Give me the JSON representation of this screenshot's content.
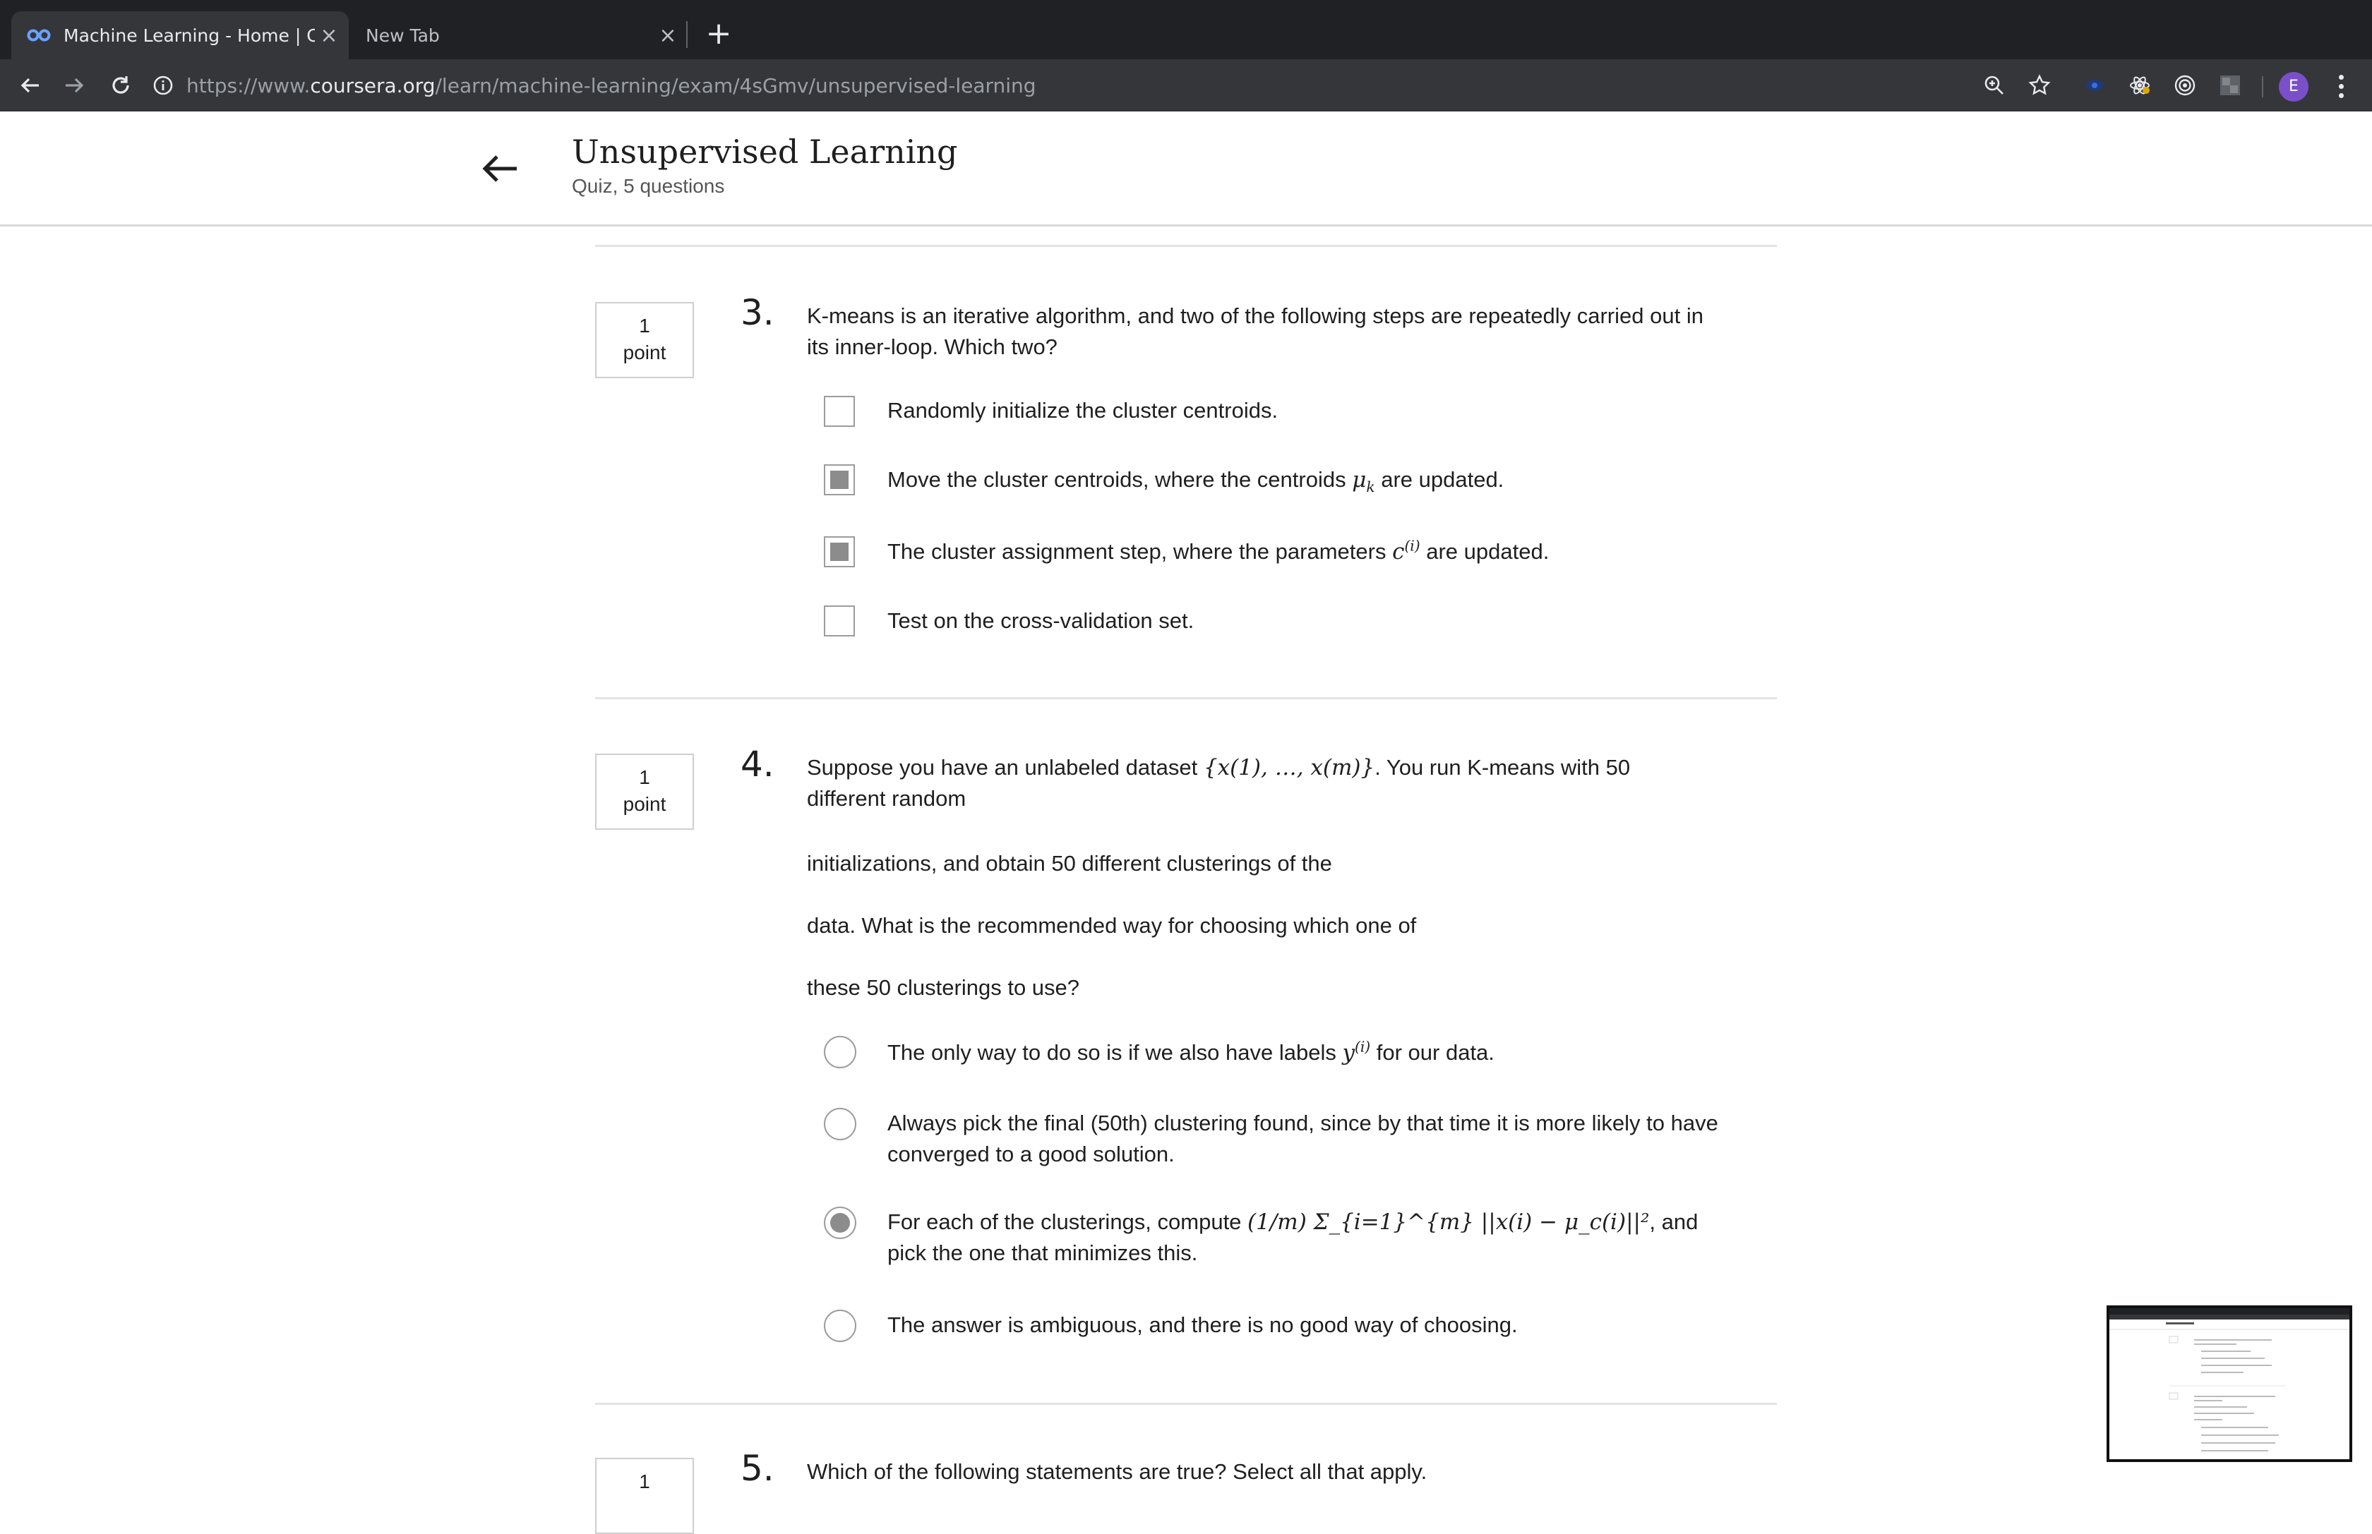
{
  "browser": {
    "tabs": [
      {
        "title": "Machine Learning - Home | Coursera",
        "active": true
      },
      {
        "title": "New Tab",
        "active": false
      }
    ],
    "url_base": "https://www.",
    "url_host": "coursera.org",
    "url_path": "/learn/machine-learning/exam/4sGmv/unsupervised-learning",
    "profile_initial": "E",
    "colors": {
      "tabbar": "#202124",
      "toolbar": "#35363a",
      "avatar": "#7b4fc9"
    }
  },
  "header": {
    "title": "Unsupervised Learning",
    "subtitle": "Quiz, 5 questions"
  },
  "questions": [
    {
      "number": "3.",
      "points_value": "1",
      "points_label": "point",
      "text": "K-means is an iterative algorithm, and two of the following steps are repeatedly carried out in its inner-loop. Which two?",
      "type": "checkbox",
      "options": [
        {
          "text": "Randomly initialize the cluster centroids.",
          "selected": false
        },
        {
          "text_before": "Move the cluster centroids, where the centroids ",
          "math": "μ",
          "math_sub": "k",
          "text_after": " are updated.",
          "selected": true
        },
        {
          "text_before": "The cluster assignment step, where the parameters ",
          "math": "c",
          "math_sup": "(i)",
          "text_after": " are updated.",
          "selected": true
        },
        {
          "text": "Test on the cross-validation set.",
          "selected": false
        }
      ]
    },
    {
      "number": "4.",
      "points_value": "1",
      "points_label": "point",
      "text_before": "Suppose you have an unlabeled dataset ",
      "math_set": "{x(1), …, x(m)}",
      "text_after": ". You run K-means with 50 different random",
      "paragraphs": [
        "initializations, and obtain 50 different clusterings of the",
        "data. What is the recommended way for choosing which one of",
        "these 50 clusterings to use?"
      ],
      "type": "radio",
      "options": [
        {
          "text_before": "The only way to do so is if we also have labels ",
          "math": "y",
          "math_sup": "(i)",
          "text_after": " for our data.",
          "selected": false
        },
        {
          "text": "Always pick the final (50th) clustering found, since by that time it is more likely to have converged to a good solution.",
          "selected": false
        },
        {
          "text_before": "For each of the clusterings, compute ",
          "math_expr": "(1/m) Σ_{i=1}^{m} ||x(i) − μ_c(i)||²",
          "text_after": ", and pick the one that minimizes this.",
          "selected": true
        },
        {
          "text": "The answer is ambiguous, and there is no good way of choosing.",
          "selected": false
        }
      ]
    },
    {
      "number": "5.",
      "points_value": "1",
      "text": "Which of the following statements are true? Select all that apply."
    }
  ]
}
